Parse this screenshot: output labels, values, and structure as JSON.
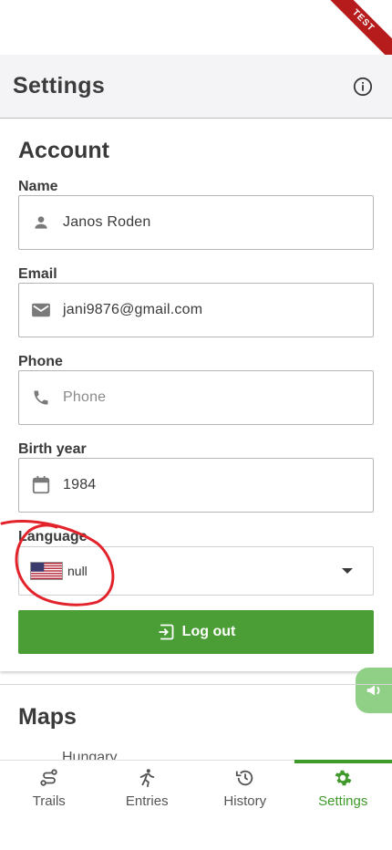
{
  "banner": {
    "text": "TEST"
  },
  "header": {
    "title": "Settings",
    "info_icon": "info-icon"
  },
  "account": {
    "title": "Account",
    "name": {
      "label": "Name",
      "value": "Janos Roden",
      "icon": "person-icon"
    },
    "email": {
      "label": "Email",
      "value": "jani9876@gmail.com",
      "icon": "mail-icon"
    },
    "phone": {
      "label": "Phone",
      "placeholder": "Phone",
      "value": "",
      "icon": "phone-icon"
    },
    "birth_year": {
      "label": "Birth year",
      "value": "1984",
      "icon": "calendar-icon"
    },
    "language": {
      "label": "Language",
      "value": "null",
      "flag": "us-flag-icon"
    },
    "logout_label": "Log out"
  },
  "maps": {
    "title": "Maps",
    "peek_item": "Hungary"
  },
  "nav": {
    "items": [
      {
        "label": "Trails",
        "icon": "trail-icon"
      },
      {
        "label": "Entries",
        "icon": "runner-icon"
      },
      {
        "label": "History",
        "icon": "history-icon"
      },
      {
        "label": "Settings",
        "icon": "gear-icon"
      }
    ],
    "active_index": 3
  },
  "colors": {
    "primary": "#4a9e35",
    "active_nav": "#3f9a2b",
    "fab": "#8fcf86",
    "test_ribbon": "#b71c1c",
    "annotation": "#e3232b"
  }
}
